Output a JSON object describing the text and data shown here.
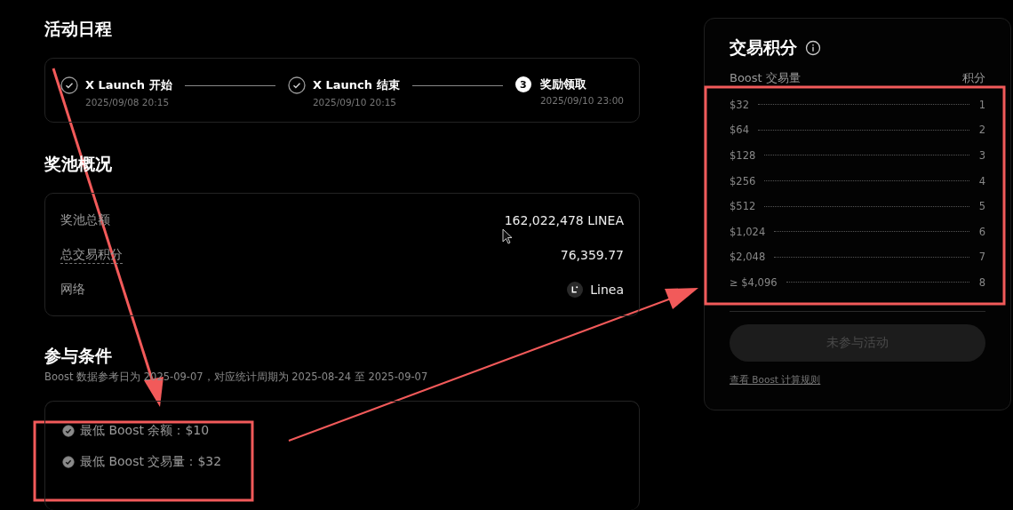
{
  "schedule": {
    "title": "活动日程",
    "steps": [
      {
        "label": "X Launch 开始",
        "time": "2025/09/08 20:15",
        "completed": true
      },
      {
        "label": "X Launch 结束",
        "time": "2025/09/10 20:15",
        "completed": true
      },
      {
        "label": "奖励领取",
        "time": "2025/09/10 23:00",
        "completed": false,
        "number": "3"
      }
    ]
  },
  "pool": {
    "title": "奖池概况",
    "rows": [
      {
        "label": "奖池总额",
        "value": "162,022,478 LINEA",
        "tooltip": false
      },
      {
        "label": "总交易积分",
        "value": "76,359.77",
        "tooltip": true
      },
      {
        "label": "网络",
        "value": "Linea",
        "tooltip": false,
        "kind": "network"
      }
    ]
  },
  "conditions": {
    "title": "参与条件",
    "note": "Boost 数据参考日为 2025-09-07，对应统计周期为 2025-08-24 至 2025-09-07",
    "items": [
      {
        "text": "最低 Boost 余额：$10",
        "met": true
      },
      {
        "text": "最低 Boost 交易量：$32",
        "met": true
      }
    ]
  },
  "points": {
    "title": "交易积分",
    "columns": [
      "Boost 交易量",
      "积分"
    ],
    "rows": [
      {
        "volume": "$32",
        "points": "1"
      },
      {
        "volume": "$64",
        "points": "2"
      },
      {
        "volume": "$128",
        "points": "3"
      },
      {
        "volume": "$256",
        "points": "4"
      },
      {
        "volume": "$512",
        "points": "5"
      },
      {
        "volume": "$1,024",
        "points": "6"
      },
      {
        "volume": "$2,048",
        "points": "7"
      },
      {
        "volume": "≥ $4,096",
        "points": "8"
      }
    ],
    "button": {
      "label": "未参与活动",
      "disabled": true
    },
    "link": "查看 Boost 计算规则"
  }
}
